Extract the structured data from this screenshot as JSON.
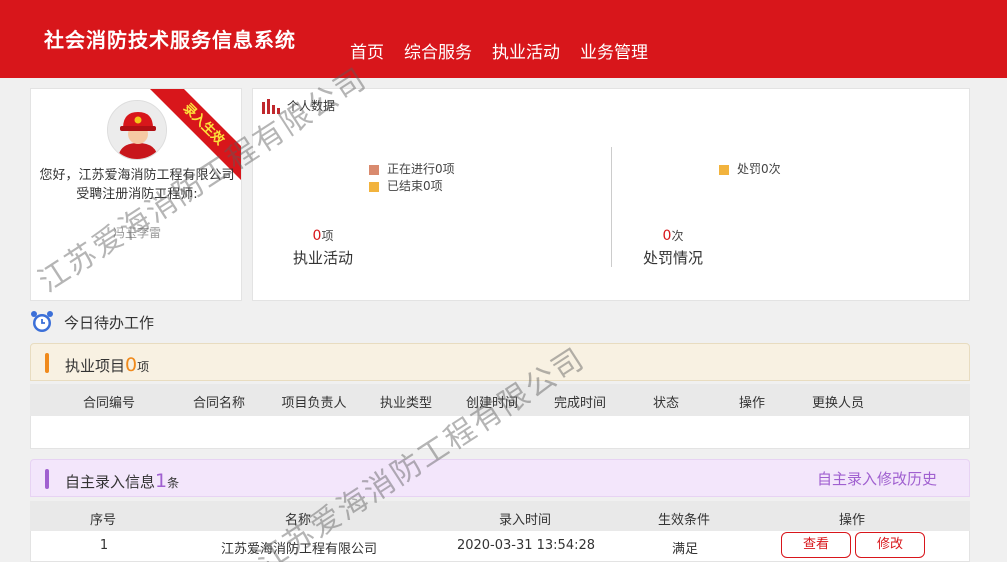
{
  "header": {
    "title": "社会消防技术服务信息系统",
    "nav": [
      "首页",
      "综合服务",
      "执业活动",
      "业务管理"
    ]
  },
  "profile": {
    "ribbon": "录入生效",
    "greeting": "您好，江苏爱海消防工程有限公司",
    "role": "受聘注册消防工程师:",
    "engineer": "冯玉李雷"
  },
  "stats": {
    "title": "个人数据",
    "legend_left": [
      "正在进行0项",
      "已结束0项"
    ],
    "legend_right": [
      "处罚0次"
    ],
    "activity": {
      "count": "0",
      "unit": "项",
      "label": "执业活动"
    },
    "penalty": {
      "count": "0",
      "unit": "次",
      "label": "处罚情况"
    },
    "colors": {
      "ongoing": "#d98a6e",
      "finished": "#f2b33d",
      "penalty": "#f2b33d"
    }
  },
  "todo": {
    "title": "今日待办工作",
    "projects": {
      "title": "执业项目",
      "count": "0",
      "unit": "项",
      "columns": [
        "合同编号",
        "合同名称",
        "项目负责人",
        "执业类型",
        "创建时间",
        "完成时间",
        "状态",
        "操作",
        "更换人员"
      ]
    },
    "self_entry": {
      "title": "自主录入信息",
      "count": "1",
      "unit": "条",
      "history_link": "自主录入修改历史",
      "columns": [
        "序号",
        "名称",
        "录入时间",
        "生效条件",
        "操作"
      ],
      "rows": [
        {
          "index": "1",
          "name": "江苏爱海消防工程有限公司",
          "time": "2020-03-31 13:54:28",
          "condition": "满足",
          "view": "查看",
          "edit": "修改"
        }
      ]
    }
  },
  "watermark": "江苏爱海消防工程有限公司",
  "accent": "#d8161b"
}
